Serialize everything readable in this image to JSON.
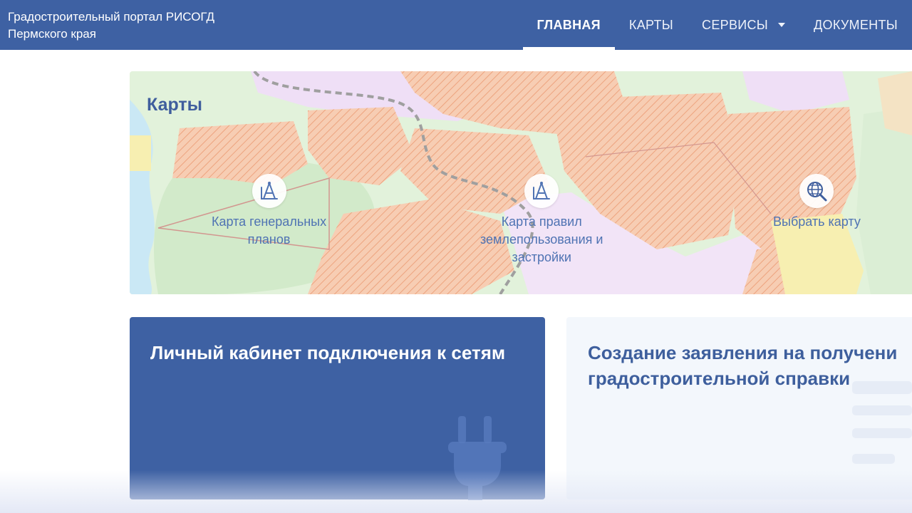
{
  "header": {
    "brand_line1": "Градостроительный портал РИСОГД",
    "brand_line2": "Пермского края",
    "nav": [
      {
        "label": "ГЛАВНАЯ",
        "active": true
      },
      {
        "label": "КАРТЫ"
      },
      {
        "label": "СЕРВИСЫ",
        "has_dropdown": true
      },
      {
        "label": "ДОКУМЕНТЫ"
      }
    ]
  },
  "maps": {
    "title": "Карты",
    "links": [
      {
        "icon": "compass-ruler-icon",
        "label_line1": "Карта генеральных",
        "label_line2": "планов"
      },
      {
        "icon": "compass-ruler-icon",
        "label_line1": "Карта правил",
        "label_line2": "землепользования и",
        "label_line3": "застройки"
      },
      {
        "icon": "globe-search-icon",
        "label_line1": "Выбрать карту"
      }
    ]
  },
  "cards": {
    "connect": {
      "title": "Личный кабинет подключения к сетям",
      "icon": "plug-icon"
    },
    "certificate": {
      "title_line1": "Создание заявления на получени",
      "title_line2": "градостроительной справки",
      "icon": "document-lines-icon"
    }
  },
  "colors": {
    "header_bg": "#3e61a3",
    "accent_text": "#3f5e9d",
    "map_zone_orange": "#f4b48f",
    "map_zone_green": "#cfe8c5",
    "map_zone_lilac": "#ecd8f4"
  }
}
